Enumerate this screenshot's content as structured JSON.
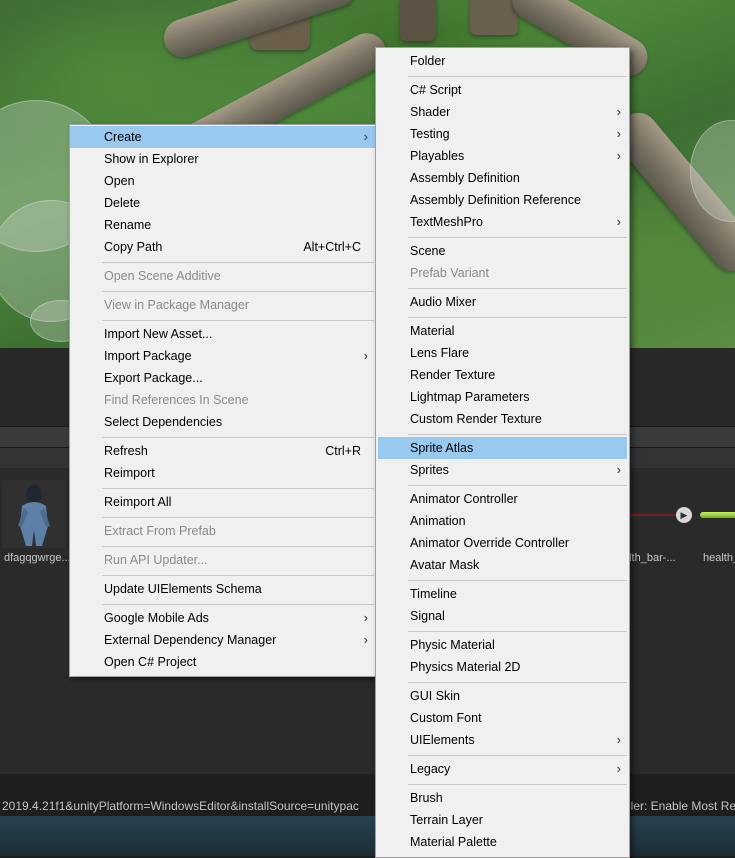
{
  "colors": {
    "highlight": "#99c9ef",
    "menu_bg": "#f0f0f0",
    "disabled_text": "#8a8a8a"
  },
  "context_menu": {
    "items": [
      {
        "label": "Create",
        "has_submenu": true,
        "highlighted": true
      },
      {
        "label": "Show in Explorer"
      },
      {
        "label": "Open"
      },
      {
        "label": "Delete"
      },
      {
        "label": "Rename"
      },
      {
        "label": "Copy Path",
        "shortcut": "Alt+Ctrl+C"
      },
      {
        "label": "Open Scene Additive",
        "disabled": true
      },
      {
        "label": "View in Package Manager",
        "disabled": true
      },
      {
        "label": "Import New Asset..."
      },
      {
        "label": "Import Package",
        "has_submenu": true
      },
      {
        "label": "Export Package..."
      },
      {
        "label": "Find References In Scene",
        "disabled": true
      },
      {
        "label": "Select Dependencies"
      },
      {
        "label": "Refresh",
        "shortcut": "Ctrl+R"
      },
      {
        "label": "Reimport"
      },
      {
        "label": "Reimport All"
      },
      {
        "label": "Extract From Prefab",
        "disabled": true
      },
      {
        "label": "Run API Updater...",
        "disabled": true
      },
      {
        "label": "Update UIElements Schema"
      },
      {
        "label": "Google Mobile Ads",
        "has_submenu": true
      },
      {
        "label": "External Dependency Manager",
        "has_submenu": true
      },
      {
        "label": "Open C# Project"
      }
    ]
  },
  "create_submenu": {
    "items": [
      {
        "label": "Folder"
      },
      {
        "label": "C# Script"
      },
      {
        "label": "Shader",
        "has_submenu": true
      },
      {
        "label": "Testing",
        "has_submenu": true
      },
      {
        "label": "Playables",
        "has_submenu": true
      },
      {
        "label": "Assembly Definition"
      },
      {
        "label": "Assembly Definition Reference"
      },
      {
        "label": "TextMeshPro",
        "has_submenu": true
      },
      {
        "label": "Scene"
      },
      {
        "label": "Prefab Variant",
        "disabled": true
      },
      {
        "label": "Audio Mixer"
      },
      {
        "label": "Material"
      },
      {
        "label": "Lens Flare"
      },
      {
        "label": "Render Texture"
      },
      {
        "label": "Lightmap Parameters"
      },
      {
        "label": "Custom Render Texture"
      },
      {
        "label": "Sprite Atlas",
        "highlighted": true
      },
      {
        "label": "Sprites",
        "has_submenu": true
      },
      {
        "label": "Animator Controller"
      },
      {
        "label": "Animation"
      },
      {
        "label": "Animator Override Controller"
      },
      {
        "label": "Avatar Mask"
      },
      {
        "label": "Timeline"
      },
      {
        "label": "Signal"
      },
      {
        "label": "Physic Material"
      },
      {
        "label": "Physics Material 2D"
      },
      {
        "label": "GUI Skin"
      },
      {
        "label": "Custom Font"
      },
      {
        "label": "UIElements",
        "has_submenu": true
      },
      {
        "label": "Legacy",
        "has_submenu": true
      },
      {
        "label": "Brush"
      },
      {
        "label": "Terrain Layer"
      },
      {
        "label": "Material Palette"
      }
    ]
  },
  "submenu_arrow": "›",
  "assets": [
    {
      "label": "dfagqgwrge..."
    },
    {
      "label": "alth_bar-..."
    },
    {
      "label": "health_"
    }
  ],
  "status_bar": {
    "left_text": "2019.4.21f1&unityPlatform=WindowsEditor&installSource=unitypac",
    "right_text": "ller: Enable Most Re"
  }
}
